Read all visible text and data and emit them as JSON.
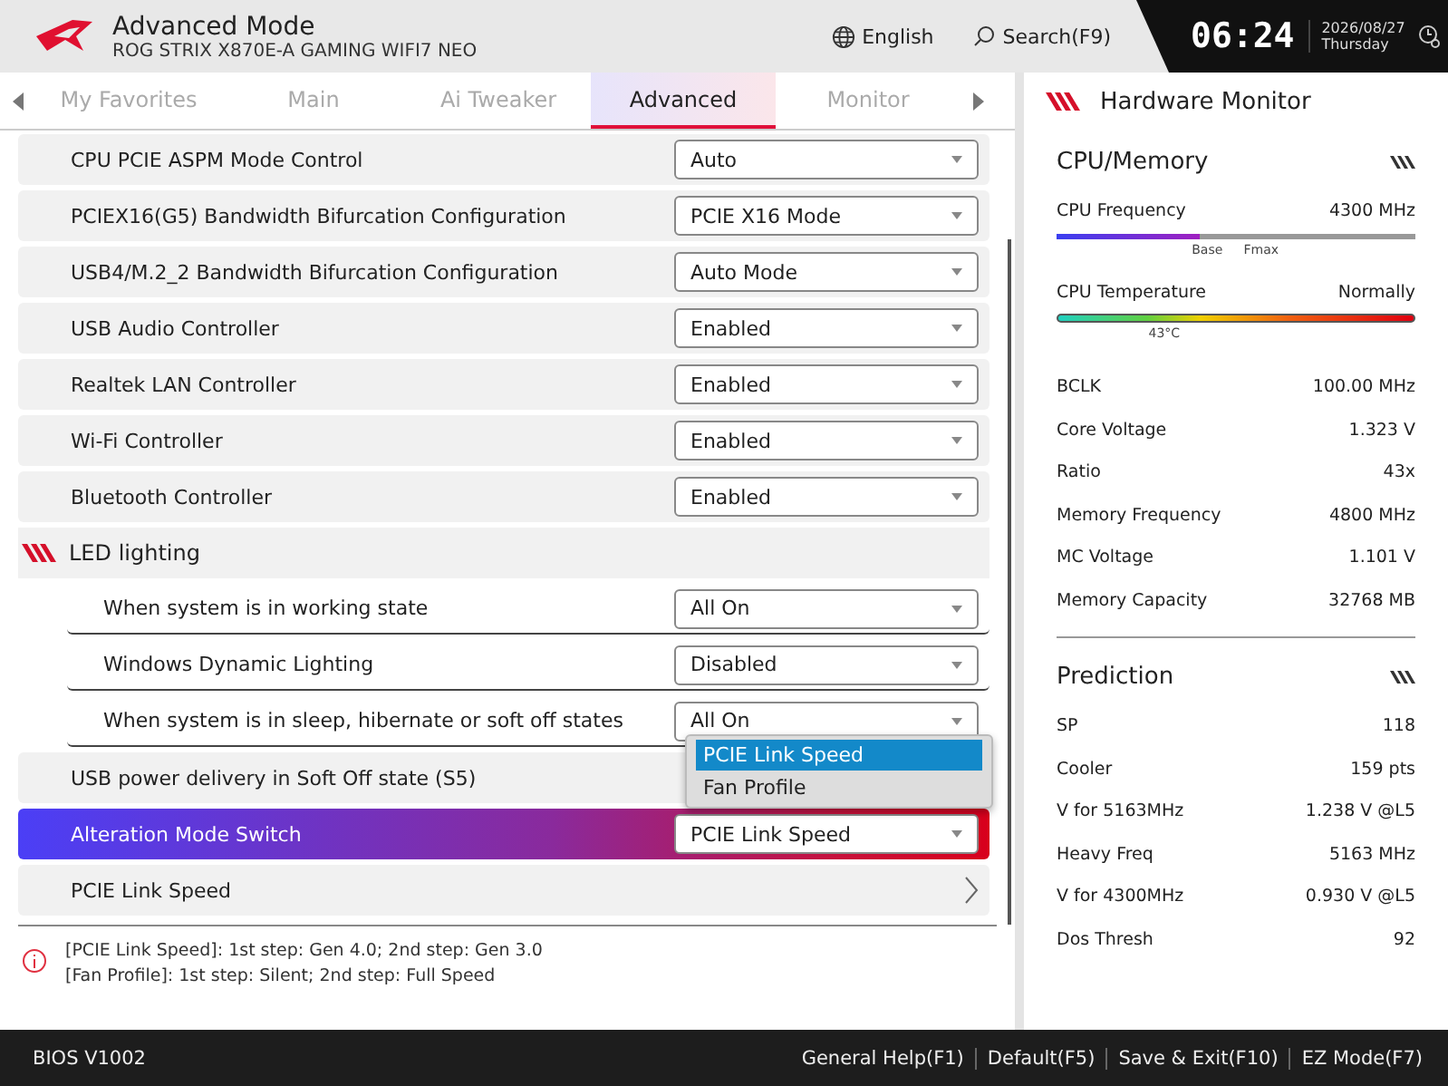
{
  "header": {
    "title": "Advanced Mode",
    "subtitle": "ROG STRIX X870E-A GAMING WIFI7 NEO",
    "language": "English",
    "search": "Search(F9)",
    "time": "06:24",
    "date": "2026/08/27",
    "day": "Thursday"
  },
  "tabs": [
    {
      "label": "My Favorites",
      "selected": false
    },
    {
      "label": "Main",
      "selected": false
    },
    {
      "label": "Ai Tweaker",
      "selected": false
    },
    {
      "label": "Advanced",
      "selected": true
    },
    {
      "label": "Monitor",
      "selected": false
    }
  ],
  "settings": [
    {
      "kind": "select",
      "label": "CPU PCIE ASPM Mode Control",
      "value": "Auto",
      "selected": false
    },
    {
      "kind": "select",
      "label": "PCIEX16(G5) Bandwidth Bifurcation Configuration",
      "value": "PCIE X16 Mode",
      "selected": false
    },
    {
      "kind": "select",
      "label": "USB4/M.2_2 Bandwidth Bifurcation Configuration",
      "value": "Auto Mode",
      "selected": false
    },
    {
      "kind": "select",
      "label": "USB Audio Controller",
      "value": "Enabled",
      "selected": false
    },
    {
      "kind": "select",
      "label": "Realtek LAN Controller",
      "value": "Enabled",
      "selected": false
    },
    {
      "kind": "select",
      "label": "Wi-Fi Controller",
      "value": "Enabled",
      "selected": false
    },
    {
      "kind": "select",
      "label": "Bluetooth Controller",
      "value": "Enabled",
      "selected": false
    },
    {
      "kind": "group",
      "label": "LED lighting",
      "selected": false,
      "children": [
        {
          "kind": "select",
          "label": "When system is in working state",
          "value": "All On"
        },
        {
          "kind": "select",
          "label": "Windows Dynamic Lighting",
          "value": "Disabled"
        },
        {
          "kind": "select",
          "label": "When system is in sleep, hibernate or soft off states",
          "value": "All On"
        }
      ]
    },
    {
      "kind": "select",
      "label": "USB power delivery in Soft Off state (S5)",
      "selected": false
    },
    {
      "kind": "select",
      "label": "Alteration Mode Switch",
      "value": "PCIE Link Speed",
      "selected": true
    },
    {
      "kind": "link",
      "label": "PCIE Link Speed",
      "selected": false
    }
  ],
  "dropdown": {
    "options": [
      {
        "label": "PCIE Link Speed",
        "selected": true
      },
      {
        "label": "Fan Profile",
        "selected": false
      }
    ]
  },
  "help": [
    "[PCIE Link Speed]: 1st step: Gen 4.0; 2nd step: Gen 3.0",
    "[Fan Profile]: 1st step: Silent; 2nd step: Full Speed"
  ],
  "monitor": {
    "title": "Hardware Monitor",
    "cpu_memory": {
      "title": "CPU/Memory",
      "frequency": {
        "label": "CPU Frequency",
        "value": "4300 MHz",
        "level": 0.4,
        "markers": [
          "Base",
          "Fmax"
        ]
      },
      "temperature": {
        "label": "CPU Temperature",
        "value": "Normally",
        "marker": "43°C"
      },
      "stats": [
        {
          "label": "BCLK",
          "value": "100.00 MHz"
        },
        {
          "label": "Core Voltage",
          "value": "1.323 V"
        },
        {
          "label": "Ratio",
          "value": "43x"
        },
        {
          "label": "Memory Frequency",
          "value": "4800 MHz"
        },
        {
          "label": "MC Voltage",
          "value": "1.101 V"
        },
        {
          "label": "Memory Capacity",
          "value": "32768 MB"
        }
      ]
    },
    "prediction": {
      "title": "Prediction",
      "stats": [
        {
          "label": "SP",
          "value": "118"
        },
        {
          "label": "Cooler",
          "value": "159 pts"
        },
        {
          "label": "V for 5163MHz",
          "value": "1.238 V @L5"
        },
        {
          "label": "Heavy Freq",
          "value": "5163 MHz"
        },
        {
          "label": "V for 4300MHz",
          "value": "0.930 V @L5"
        },
        {
          "label": "Dos Thresh",
          "value": "92"
        }
      ]
    }
  },
  "footer": {
    "version": "BIOS V1002",
    "actions": [
      "General Help(F1)",
      "Default(F5)",
      "Save & Exit(F10)",
      "EZ Mode(F7)"
    ]
  }
}
